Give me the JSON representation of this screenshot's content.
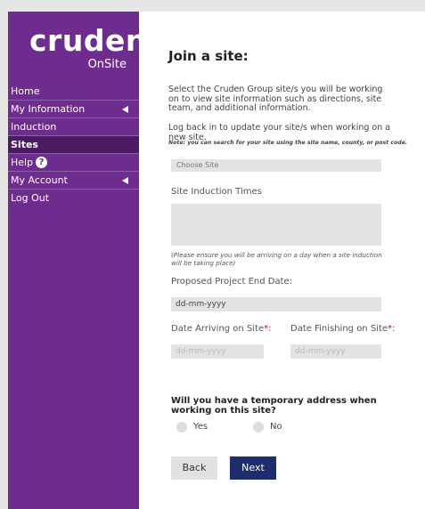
{
  "brand": {
    "logo_word": "cruden",
    "logo_sub": "OnSite",
    "sidebar_color": "#6f2c8f",
    "next_button_color": "#1e2d6e"
  },
  "nav": {
    "items": [
      {
        "label": "Home",
        "has_arrow": false,
        "active": false
      },
      {
        "label": "My Information",
        "has_arrow": true,
        "active": false
      },
      {
        "label": "Induction",
        "has_arrow": false,
        "active": false
      },
      {
        "label": "Sites",
        "has_arrow": false,
        "active": true
      },
      {
        "label": "Help",
        "has_arrow": false,
        "active": false,
        "badge": "?"
      },
      {
        "label": "My Account",
        "has_arrow": true,
        "active": false
      },
      {
        "label": "Log Out",
        "has_arrow": false,
        "active": false
      }
    ]
  },
  "page": {
    "title": "Join a site:",
    "intro": "Select the Cruden Group site/s you will be working on to view site information such as directions, site team, and additional information.",
    "intro2": "Log back in to update your site/s when working on a new site.",
    "note": "Note: you can search for your site using the site name, county, or post code."
  },
  "form": {
    "choose_site_placeholder": "Choose Site",
    "induction_times_label": "Site Induction Times",
    "ensure_note": "(Please ensure you will be arriving on a day when a site induction will be taking place)",
    "end_date_label": "Proposed Project End Date:",
    "end_date_value": "dd-mm-yyyy",
    "arriving_label": "Date Arriving on Site",
    "finishing_label": "Date Finishing on Site",
    "required_mark": "*",
    "label_suffix": ":",
    "arriving_placeholder": "dd-mm-yyyy",
    "finishing_placeholder": "dd-mm-yyyy",
    "temp_address_question": "Will you have a temporary address when working on this site?",
    "yes_label": "Yes",
    "no_label": "No",
    "back_label": "Back",
    "next_label": "Next"
  }
}
